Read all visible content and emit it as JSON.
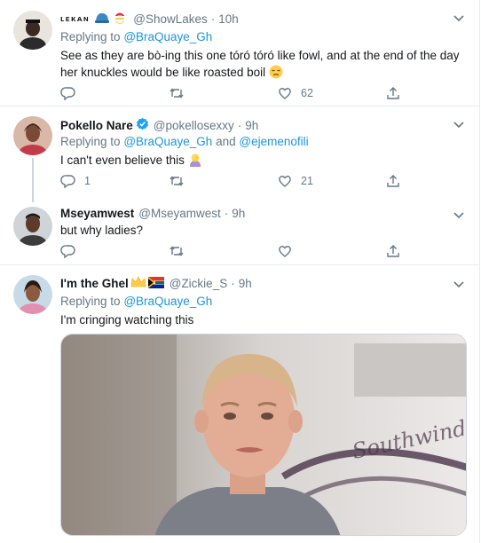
{
  "tweets": [
    {
      "name": "ʟᴇᴋᴀɴ",
      "handle": "@ShowLakes",
      "time": "10h",
      "reply_prefix": "Replying to",
      "reply_to": "@BraQuaye_Gh",
      "text_line1": "See as they are bò-ing this one tóró tóró like fowl, and at the end of the day",
      "text_line2": "her knuckles would be like roasted boil",
      "reply_count": "",
      "retweet_count": "",
      "like_count": "62"
    },
    {
      "name": "Pokello Nare",
      "handle": "@pokellosexxy",
      "time": "9h",
      "reply_prefix": "Replying to",
      "reply_to": "@BraQuaye_Gh",
      "reply_and": "and",
      "reply_to2": "@ejemenofili",
      "text": "I can't even believe this",
      "reply_count": "1",
      "retweet_count": "",
      "like_count": "21"
    },
    {
      "name": "Mseyamwest",
      "handle": "@Mseyamwest",
      "time": "9h",
      "text": "but why ladies?",
      "reply_count": "",
      "retweet_count": "",
      "like_count": ""
    },
    {
      "name": "I'm the Ghel",
      "handle": "@Zickie_S",
      "time": "9h",
      "reply_prefix": "Replying to",
      "reply_to": "@BraQuaye_Gh",
      "text": "I'm cringing watching this",
      "media_caption": "Southwind"
    }
  ],
  "separator": "·",
  "icons": [
    "reply-icon",
    "retweet-icon",
    "like-icon",
    "share-icon",
    "chevron-down-icon",
    "verified-badge-icon"
  ],
  "colors": {
    "link": "#1b95e0",
    "muted": "#657786",
    "text": "#14171a",
    "border": "#e6ecf0",
    "verified": "#1da1f2"
  }
}
